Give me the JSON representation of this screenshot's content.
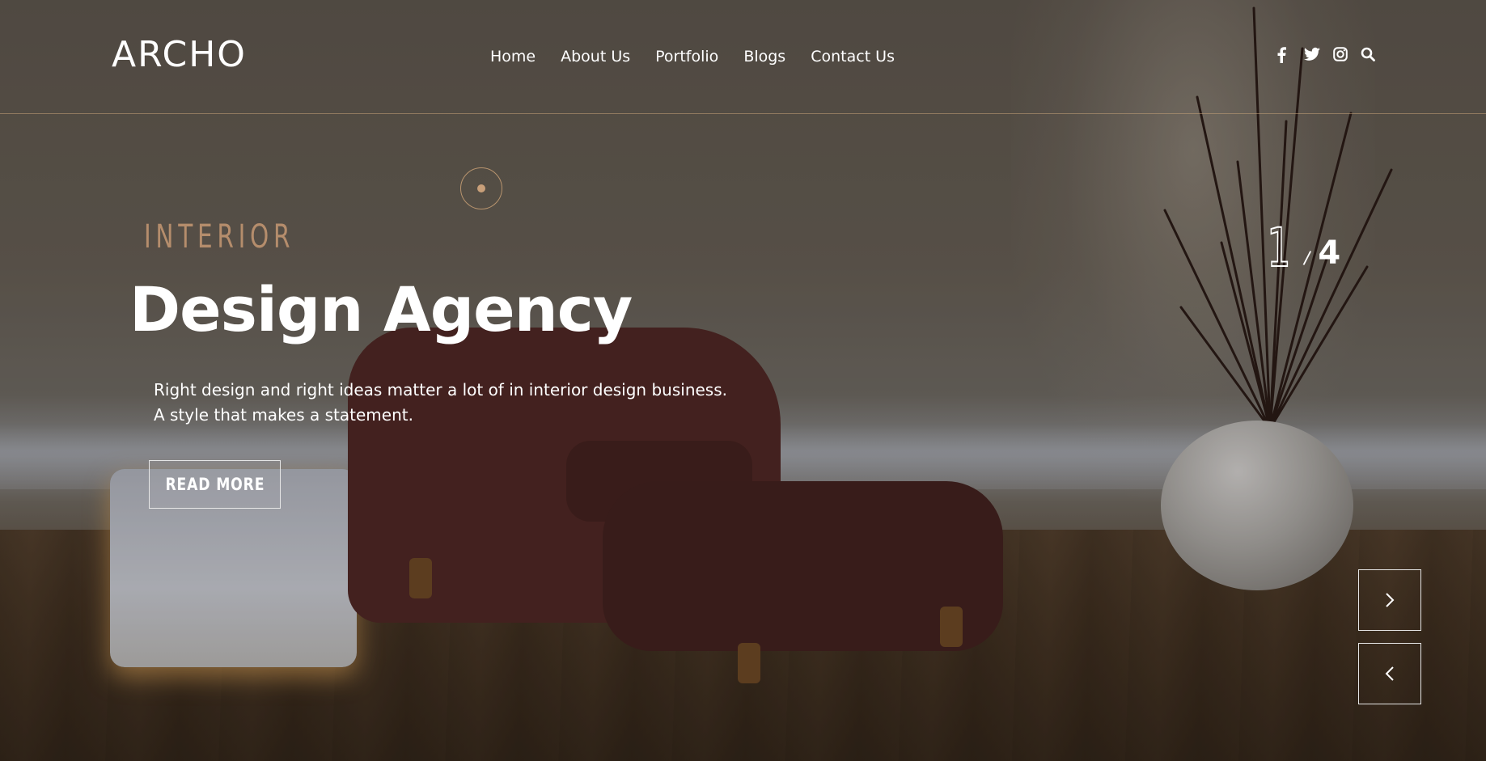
{
  "brand": {
    "logo_text": "ARCHO"
  },
  "nav": {
    "items": [
      {
        "label": "Home"
      },
      {
        "label": "About Us"
      },
      {
        "label": "Portfolio"
      },
      {
        "label": "Blogs"
      },
      {
        "label": "Contact Us"
      }
    ]
  },
  "social": {
    "icons": [
      "facebook-icon",
      "twitter-icon",
      "instagram-icon",
      "search-icon"
    ]
  },
  "hero": {
    "kicker": "INTERIOR",
    "headline": "Design Agency",
    "description_line1": "Right design and right ideas matter a lot of in interior design business.",
    "description_line2": "A style that makes a statement.",
    "cta_label": "READ MORE"
  },
  "slider": {
    "current": "1",
    "separator": "/",
    "total": "4",
    "next_icon": "chevron-right-icon",
    "prev_icon": "chevron-left-icon"
  },
  "colors": {
    "accent": "#b58d6c",
    "divider": "#c2a078",
    "text": "#ffffff"
  }
}
